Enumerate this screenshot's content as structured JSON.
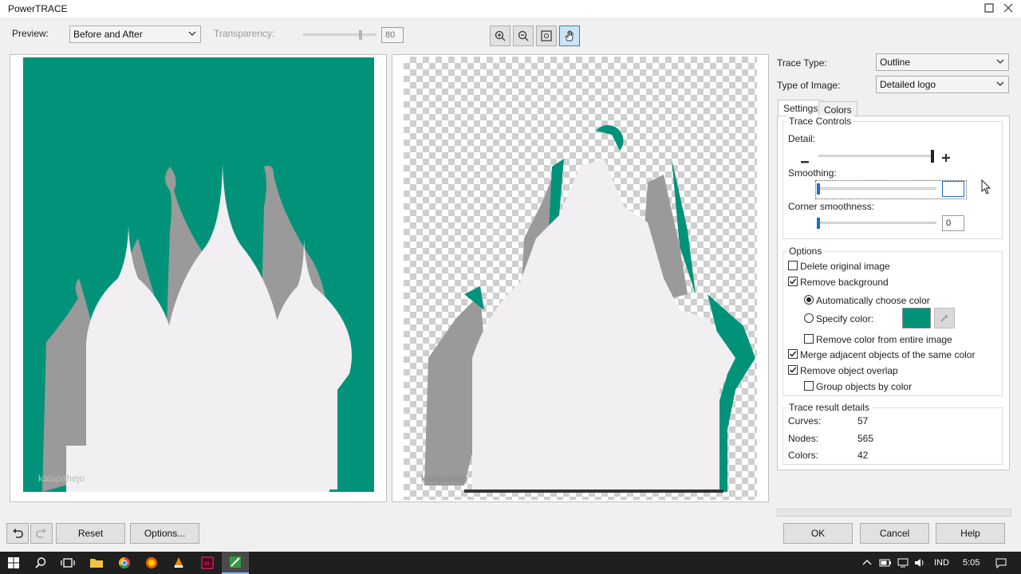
{
  "window": {
    "title": "PowerTRACE"
  },
  "toolbar": {
    "preview_label": "Preview:",
    "preview_value": "Before and After",
    "transparency_label": "Transparency:",
    "transparency_value": "80",
    "transparency_level": 0.8
  },
  "preview": {
    "watermark_before": "kalapahejo",
    "watermark_after": "kalapahejo",
    "before_bg_color": "#00937a",
    "dome_color": "#f1eff1",
    "shadow_color": "#9a9a9a"
  },
  "trace": {
    "type_label": "Trace Type:",
    "type_value": "Outline",
    "image_label": "Type of Image:",
    "image_value": "Detailed logo"
  },
  "tabs": {
    "settings": "Settings",
    "colors": "Colors"
  },
  "trace_controls": {
    "title": "Trace Controls",
    "detail_label": "Detail:",
    "detail_level": 1.0,
    "smoothing_label": "Smoothing:",
    "smoothing_value": "",
    "smoothing_level": 0.0,
    "corner_label": "Corner smoothness:",
    "corner_value": "0",
    "corner_level": 0.0
  },
  "options": {
    "title": "Options",
    "delete_original": "Delete original image",
    "remove_background": "Remove background",
    "auto_choose": "Automatically choose color",
    "specify_color": "Specify color:",
    "specify_swatch_color": "#00937a",
    "remove_entire": "Remove color from entire image",
    "merge_adjacent": "Merge adjacent objects of the same color",
    "remove_overlap": "Remove object overlap",
    "group_by_color": "Group objects by color"
  },
  "results": {
    "title": "Trace result details",
    "curves_label": "Curves:",
    "curves_value": "57",
    "nodes_label": "Nodes:",
    "nodes_value": "565",
    "colors_label": "Colors:",
    "colors_value": "42"
  },
  "buttons": {
    "reset": "Reset",
    "options": "Options...",
    "ok": "OK",
    "cancel": "Cancel",
    "help": "Help"
  },
  "taskbar": {
    "language": "IND",
    "time": "5:05"
  }
}
